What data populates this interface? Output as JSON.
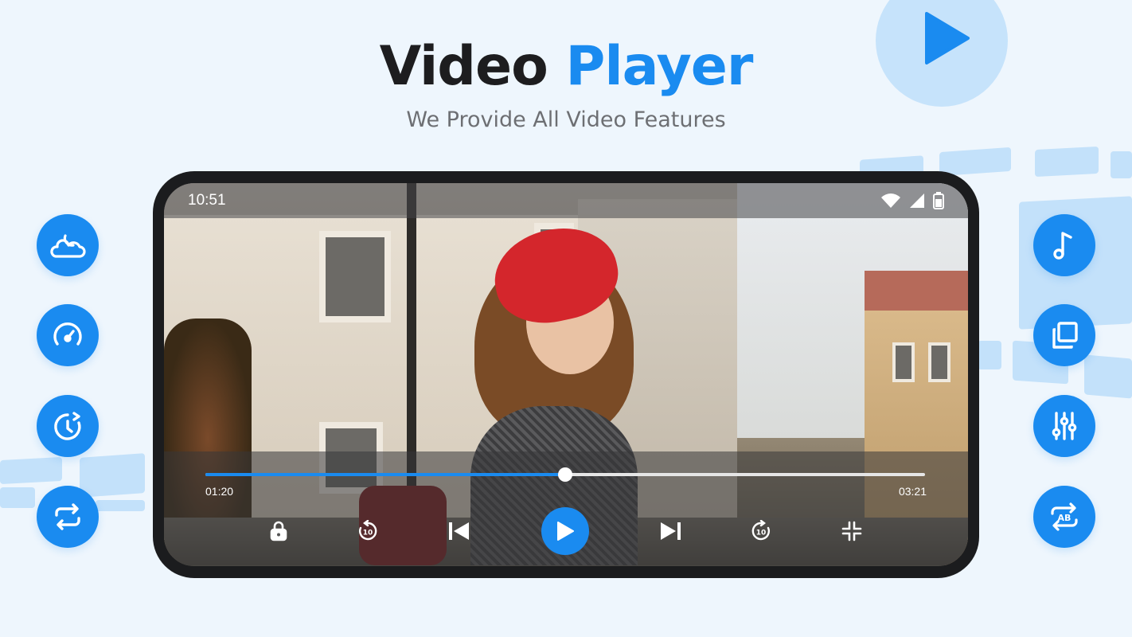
{
  "header": {
    "title_part1": "Video",
    "title_part2": "Player",
    "subtitle": "We Provide All Video Features"
  },
  "colors": {
    "accent": "#1a8bf0",
    "background": "#eef6fd",
    "title_dark": "#1d1d1f",
    "subtitle_gray": "#6d6f73",
    "phone_frame": "#1b1c1e"
  },
  "left_features": [
    {
      "icon": "cloud-night-icon"
    },
    {
      "icon": "speed-gauge-icon"
    },
    {
      "icon": "sleep-timer-icon"
    },
    {
      "icon": "repeat-icon"
    }
  ],
  "right_features": [
    {
      "icon": "music-note-icon"
    },
    {
      "icon": "copy-pip-icon"
    },
    {
      "icon": "equalizer-icon"
    },
    {
      "icon": "ab-repeat-icon"
    }
  ],
  "player": {
    "status_time": "10:51",
    "current_time": "01:20",
    "total_time": "03:21",
    "progress": 0.5,
    "controls": [
      "lock-icon",
      "rewind-10-icon",
      "skip-previous-icon",
      "play-icon",
      "skip-next-icon",
      "forward-10-icon",
      "fullscreen-exit-icon"
    ]
  }
}
